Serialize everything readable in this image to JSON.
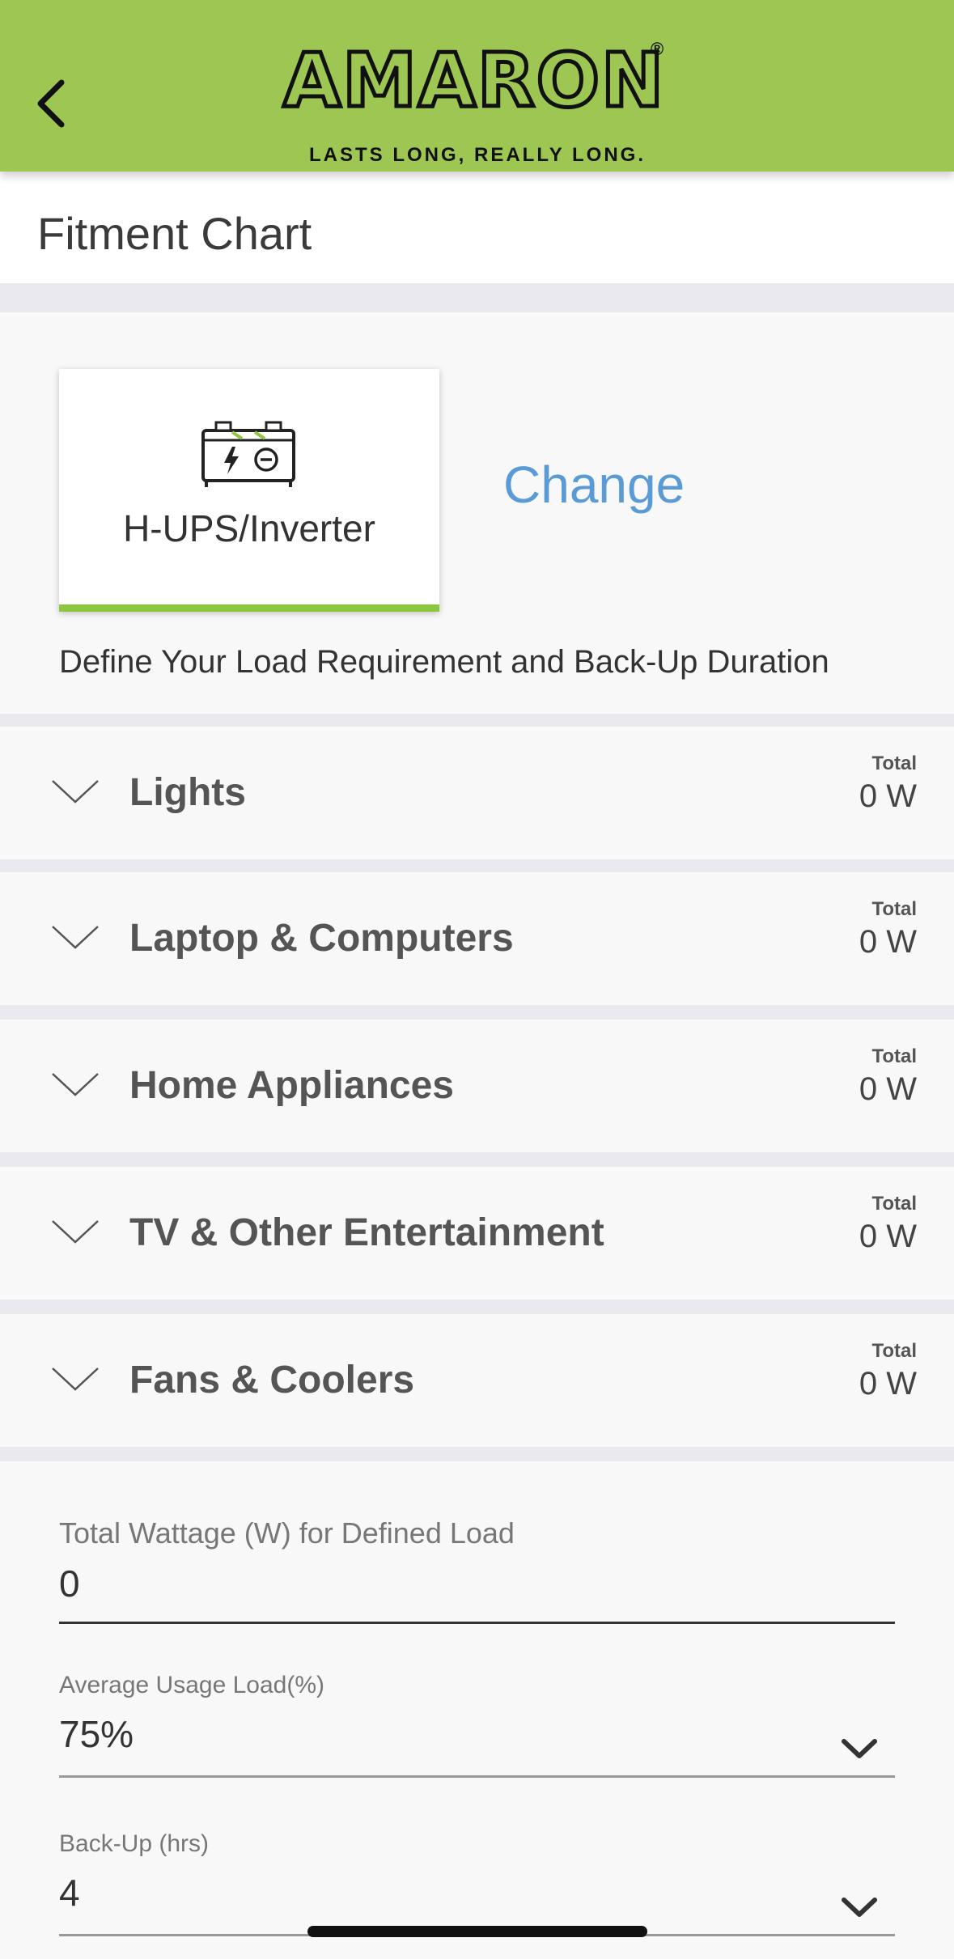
{
  "header": {
    "brand": "AMARON",
    "registered_mark": "®",
    "tagline": "LASTS LONG, REALLY LONG.",
    "back_icon": "chevron-left-icon",
    "background_color": "#9dc653"
  },
  "page": {
    "title": "Fitment Chart"
  },
  "product": {
    "icon": "battery-icon",
    "name": "H-UPS/Inverter",
    "change_label": "Change",
    "accent_color": "#8dc63f",
    "link_color": "#5b9bd5"
  },
  "define_text": "Define Your Load Requirement and Back-Up Duration",
  "categories": [
    {
      "label": "Lights",
      "total_label": "Total",
      "total_value": "0 W"
    },
    {
      "label": "Laptop & Computers",
      "total_label": "Total",
      "total_value": "0 W"
    },
    {
      "label": "Home Appliances",
      "total_label": "Total",
      "total_value": "0 W"
    },
    {
      "label": "TV & Other Entertainment",
      "total_label": "Total",
      "total_value": "0 W"
    },
    {
      "label": "Fans & Coolers",
      "total_label": "Total",
      "total_value": "0 W"
    }
  ],
  "form": {
    "total_wattage": {
      "label": "Total Wattage (W) for Defined Load",
      "value": "0"
    },
    "avg_usage": {
      "label": "Average Usage Load(%)",
      "value": "75%"
    },
    "backup": {
      "label": "Back-Up (hrs)",
      "value": "4"
    }
  }
}
